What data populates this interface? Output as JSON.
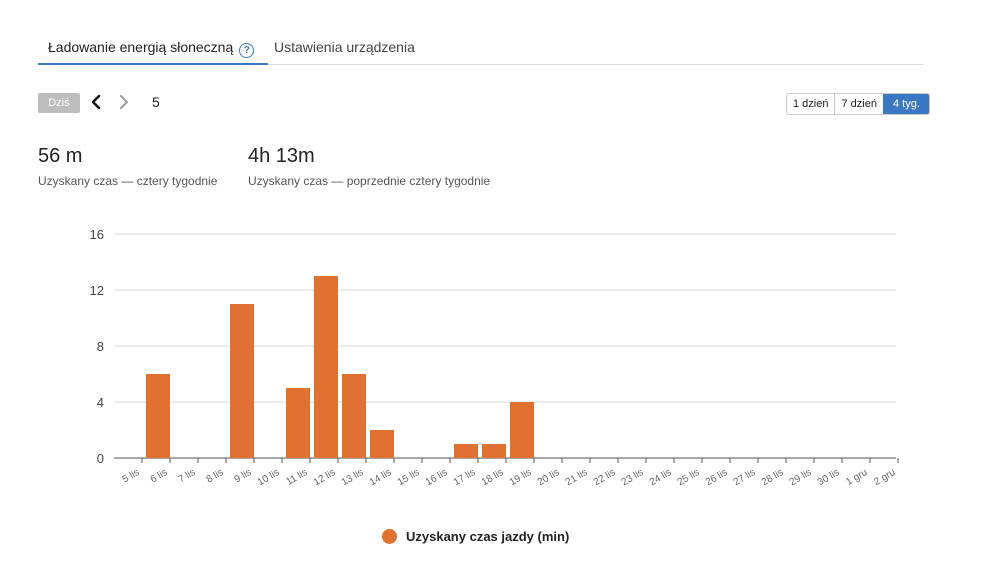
{
  "tabs": [
    {
      "label": "Ładowanie energią słoneczną",
      "active": true
    },
    {
      "label": "Ustawienia urządzenia",
      "active": false
    }
  ],
  "help_icon_glyph": "?",
  "toolbar": {
    "today_label": "Dziś",
    "page_number": "5",
    "ranges": [
      {
        "label": "1 dzień",
        "active": false
      },
      {
        "label": "7 dzień",
        "active": false
      },
      {
        "label": "4 tyg.",
        "active": true
      }
    ]
  },
  "stats": [
    {
      "value": "56 m",
      "label": "Uzyskany czas — cztery tygodnie"
    },
    {
      "value": "4h 13m",
      "label": "Uzyskany czas — poprzednie cztery tygodnie"
    }
  ],
  "colors": {
    "accent": "#3b78c4",
    "bar": "#e07130"
  },
  "icons": {
    "help": "help-circle-icon",
    "prev": "chevron-left-icon",
    "next": "chevron-right-icon"
  },
  "chart_data": {
    "type": "bar",
    "categories": [
      "5 lis",
      "6 lis",
      "7 lis",
      "8 lis",
      "9 lis",
      "10 lis",
      "11 lis",
      "12 lis",
      "13 lis",
      "14 lis",
      "15 lis",
      "16 lis",
      "17 lis",
      "18 lis",
      "19 lis",
      "20 lis",
      "21 lis",
      "22 lis",
      "23 lis",
      "24 lis",
      "25 lis",
      "26 lis",
      "27 lis",
      "28 lis",
      "29 lis",
      "30 lis",
      "1 gru",
      "2 gru"
    ],
    "series": [
      {
        "name": "Uzyskany czas jazdy (min)",
        "values": [
          0,
          6,
          0,
          0,
          11,
          0,
          5,
          13,
          6,
          2,
          0,
          0,
          1,
          1,
          4,
          0,
          0,
          0,
          0,
          0,
          0,
          0,
          0,
          0,
          0,
          0,
          0,
          0
        ]
      }
    ],
    "ylim": [
      0,
      16
    ],
    "yticks": [
      0,
      4,
      8,
      12,
      16
    ],
    "grid": true,
    "legend_position": "bottom-center"
  }
}
